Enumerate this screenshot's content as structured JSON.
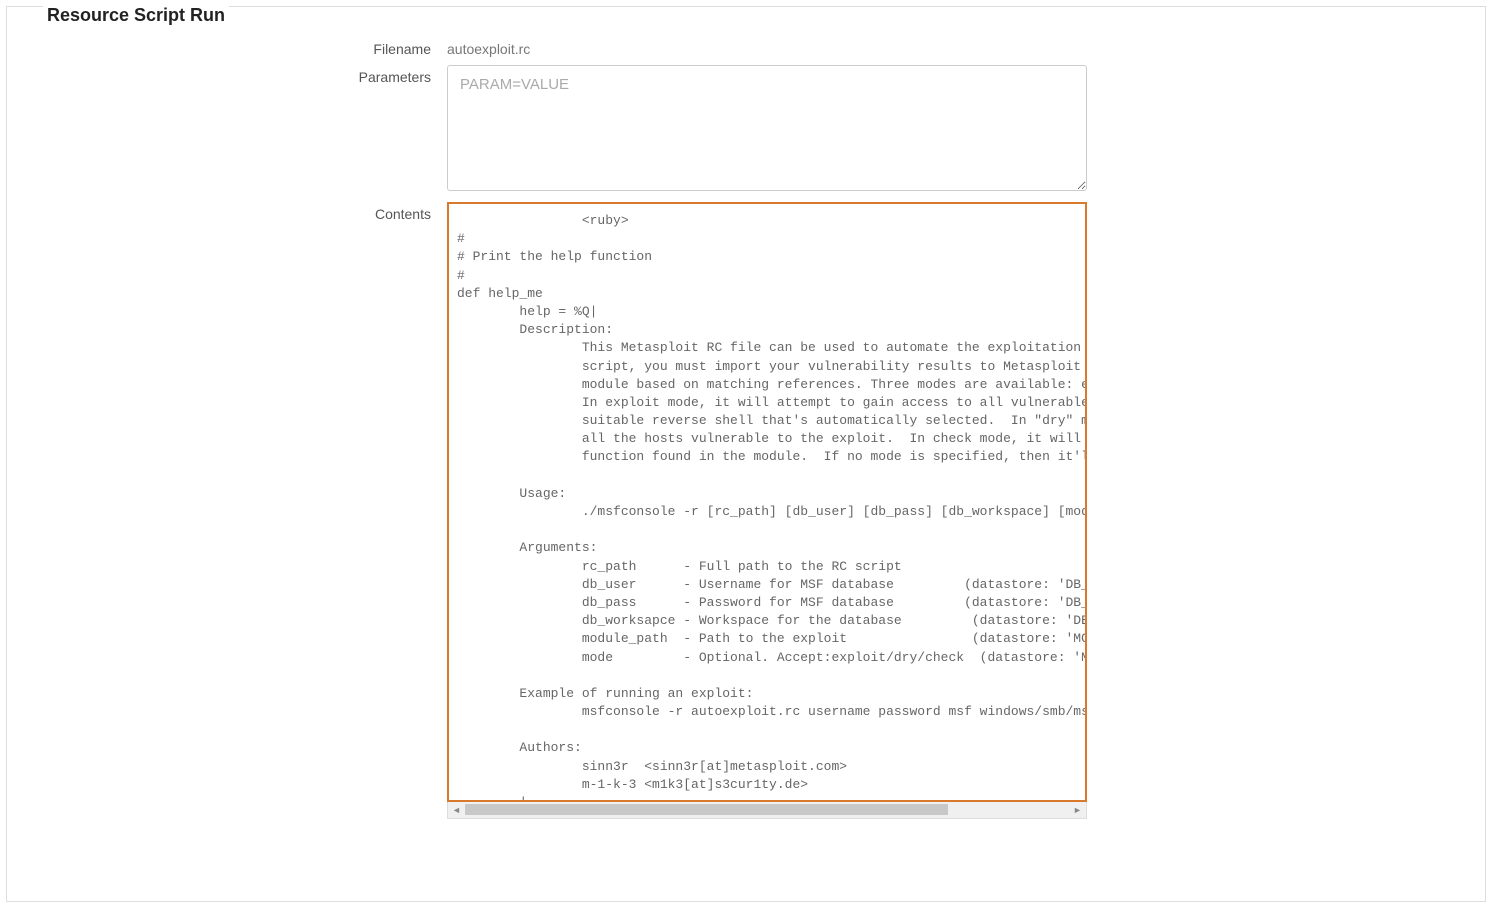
{
  "title": "Resource Script Run",
  "form": {
    "filename_label": "Filename",
    "filename_value": "autoexploit.rc",
    "parameters_label": "Parameters",
    "parameters_placeholder": "PARAM=VALUE",
    "parameters_value": "",
    "contents_label": "Contents",
    "contents_value": "                <ruby>\n#\n# Print the help function\n#\ndef help_me\n        help = %Q|\n        Description:\n                This Metasploit RC file can be used to automate the exploitation process.\n                script, you must import your vulnerability results to Metasploit so that i\n                module based on matching references. Three modes are available: exploit/dr\n                In exploit mode, it will attempt to gain access to all vulnerable hosts wi\n                suitable reverse shell that's automatically selected.  In \"dry\" mode (dry-\n                all the hosts vulnerable to the exploit.  In check mode, it will only trig\n                function found in the module.  If no mode is specified, then it'll default\n\n        Usage:\n                ./msfconsole -r [rc_path] [db_user] [db_pass] [db_workspace] [module_path]\n\n        Arguments:\n                rc_path      - Full path to the RC script\n                db_user      - Username for MSF database         (datastore: 'DB_USER')\n                db_pass      - Password for MSF database         (datastore: 'DB_PASS')\n                db_worksapce - Workspace for the database         (datastore: 'DB_WORKSPA\n                module_path  - Path to the exploit                (datastore: 'MODULE')\n                mode         - Optional. Accept:exploit/dry/check  (datastore: 'MODE')\n\n        Example of running an exploit:\n                msfconsole -r autoexploit.rc username password msf windows/smb/ms08_067_ne\n\n        Authors:\n                sinn3r  <sinn3r[at]metasploit.com>\n                m-1-k-3 <m1k3[at]s3cur1ty.de>\n        |\n"
  }
}
